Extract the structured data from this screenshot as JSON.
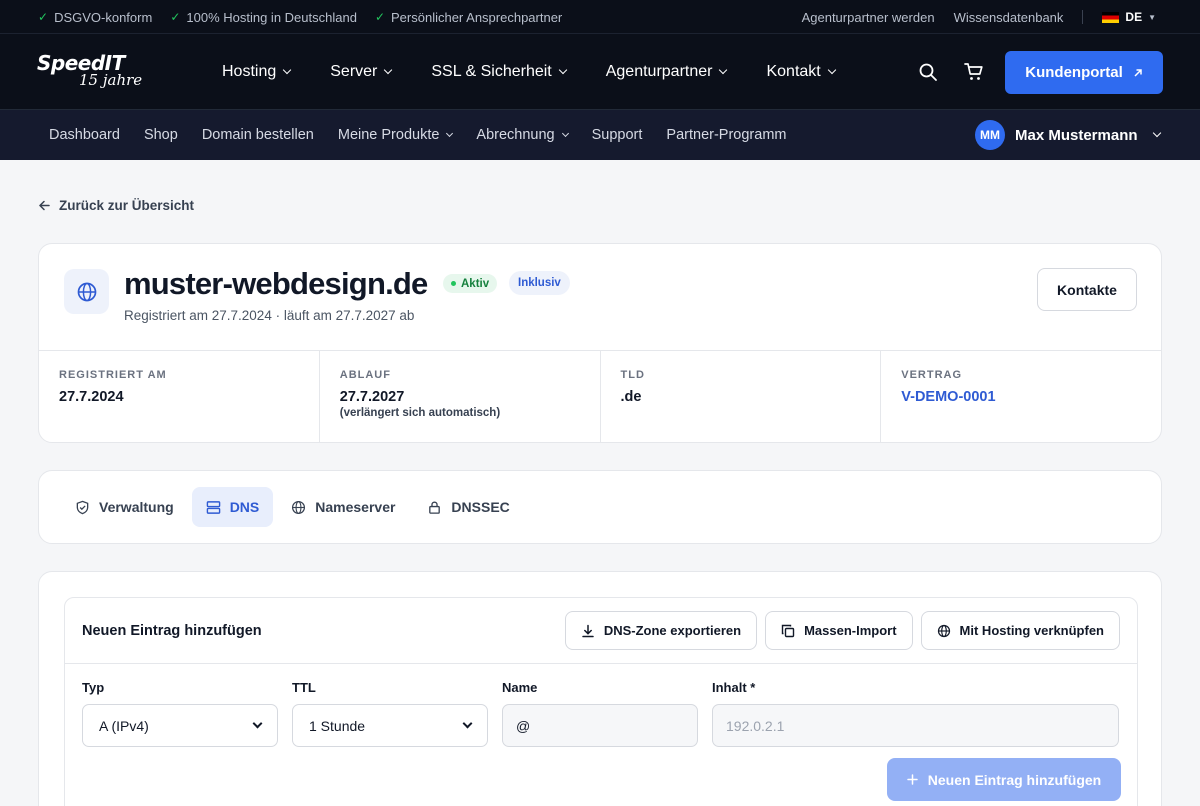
{
  "topbar": {
    "features": [
      "DSGVO-konform",
      "100% Hosting in Deutschland",
      "Persönlicher Ansprechpartner"
    ],
    "links": [
      "Agenturpartner werden",
      "Wissensdatenbank"
    ],
    "language": "DE"
  },
  "logo": {
    "brand": "SpeedIT",
    "tagline": "15 jahre"
  },
  "nav": {
    "items": [
      "Hosting",
      "Server",
      "SSL & Sicherheit",
      "Agenturpartner",
      "Kontakt"
    ],
    "portal_label": "Kundenportal",
    "icons": [
      "search-icon",
      "cart-icon"
    ]
  },
  "subnav": {
    "items": [
      {
        "label": "Dashboard",
        "dropdown": false
      },
      {
        "label": "Shop",
        "dropdown": false
      },
      {
        "label": "Domain bestellen",
        "dropdown": false
      },
      {
        "label": "Meine Produkte",
        "dropdown": true
      },
      {
        "label": "Abrechnung",
        "dropdown": true
      },
      {
        "label": "Support",
        "dropdown": false
      },
      {
        "label": "Partner-Programm",
        "dropdown": false
      }
    ],
    "user_initials": "MM",
    "user_name": "Max Mustermann"
  },
  "back_link": "Zurück zur Übersicht",
  "domain": {
    "name": "muster-webdesign.de",
    "status": "Aktiv",
    "tag": "Inklusiv",
    "subtitle": "Registriert am 27.7.2024 · läuft am 27.7.2027 ab",
    "contacts_button": "Kontakte",
    "info": [
      {
        "label": "Registriert am",
        "value": "27.7.2024",
        "note": ""
      },
      {
        "label": "Ablauf",
        "value": "27.7.2027",
        "note": "(verlängert sich automatisch)"
      },
      {
        "label": "TLD",
        "value": ".de",
        "note": ""
      },
      {
        "label": "Vertrag",
        "value": "V-DEMO-0001",
        "note": ""
      }
    ]
  },
  "tabs": [
    {
      "label": "Verwaltung",
      "icon": "shield-check-icon",
      "active": false
    },
    {
      "label": "DNS",
      "icon": "server-icon",
      "active": true
    },
    {
      "label": "Nameserver",
      "icon": "globe-icon",
      "active": false
    },
    {
      "label": "DNSSEC",
      "icon": "lock-icon",
      "active": false
    }
  ],
  "dns": {
    "section_title": "Neuen Eintrag hinzufügen",
    "actions": [
      {
        "label": "DNS-Zone exportieren",
        "icon": "download-icon"
      },
      {
        "label": "Massen-Import",
        "icon": "copy-icon"
      },
      {
        "label": "Mit Hosting verknüpfen",
        "icon": "globe-icon"
      }
    ],
    "form": {
      "type_label": "Typ",
      "type_value": "A (IPv4)",
      "ttl_label": "TTL",
      "ttl_value": "1 Stunde",
      "name_label": "Name",
      "name_value": "@",
      "content_label": "Inhalt *",
      "content_placeholder": "192.0.2.1"
    },
    "submit_label": "Neuen Eintrag hinzufügen"
  },
  "colors": {
    "accent": "#2f6bf0",
    "dark": "#0b0f19",
    "success": "#22c55e"
  }
}
